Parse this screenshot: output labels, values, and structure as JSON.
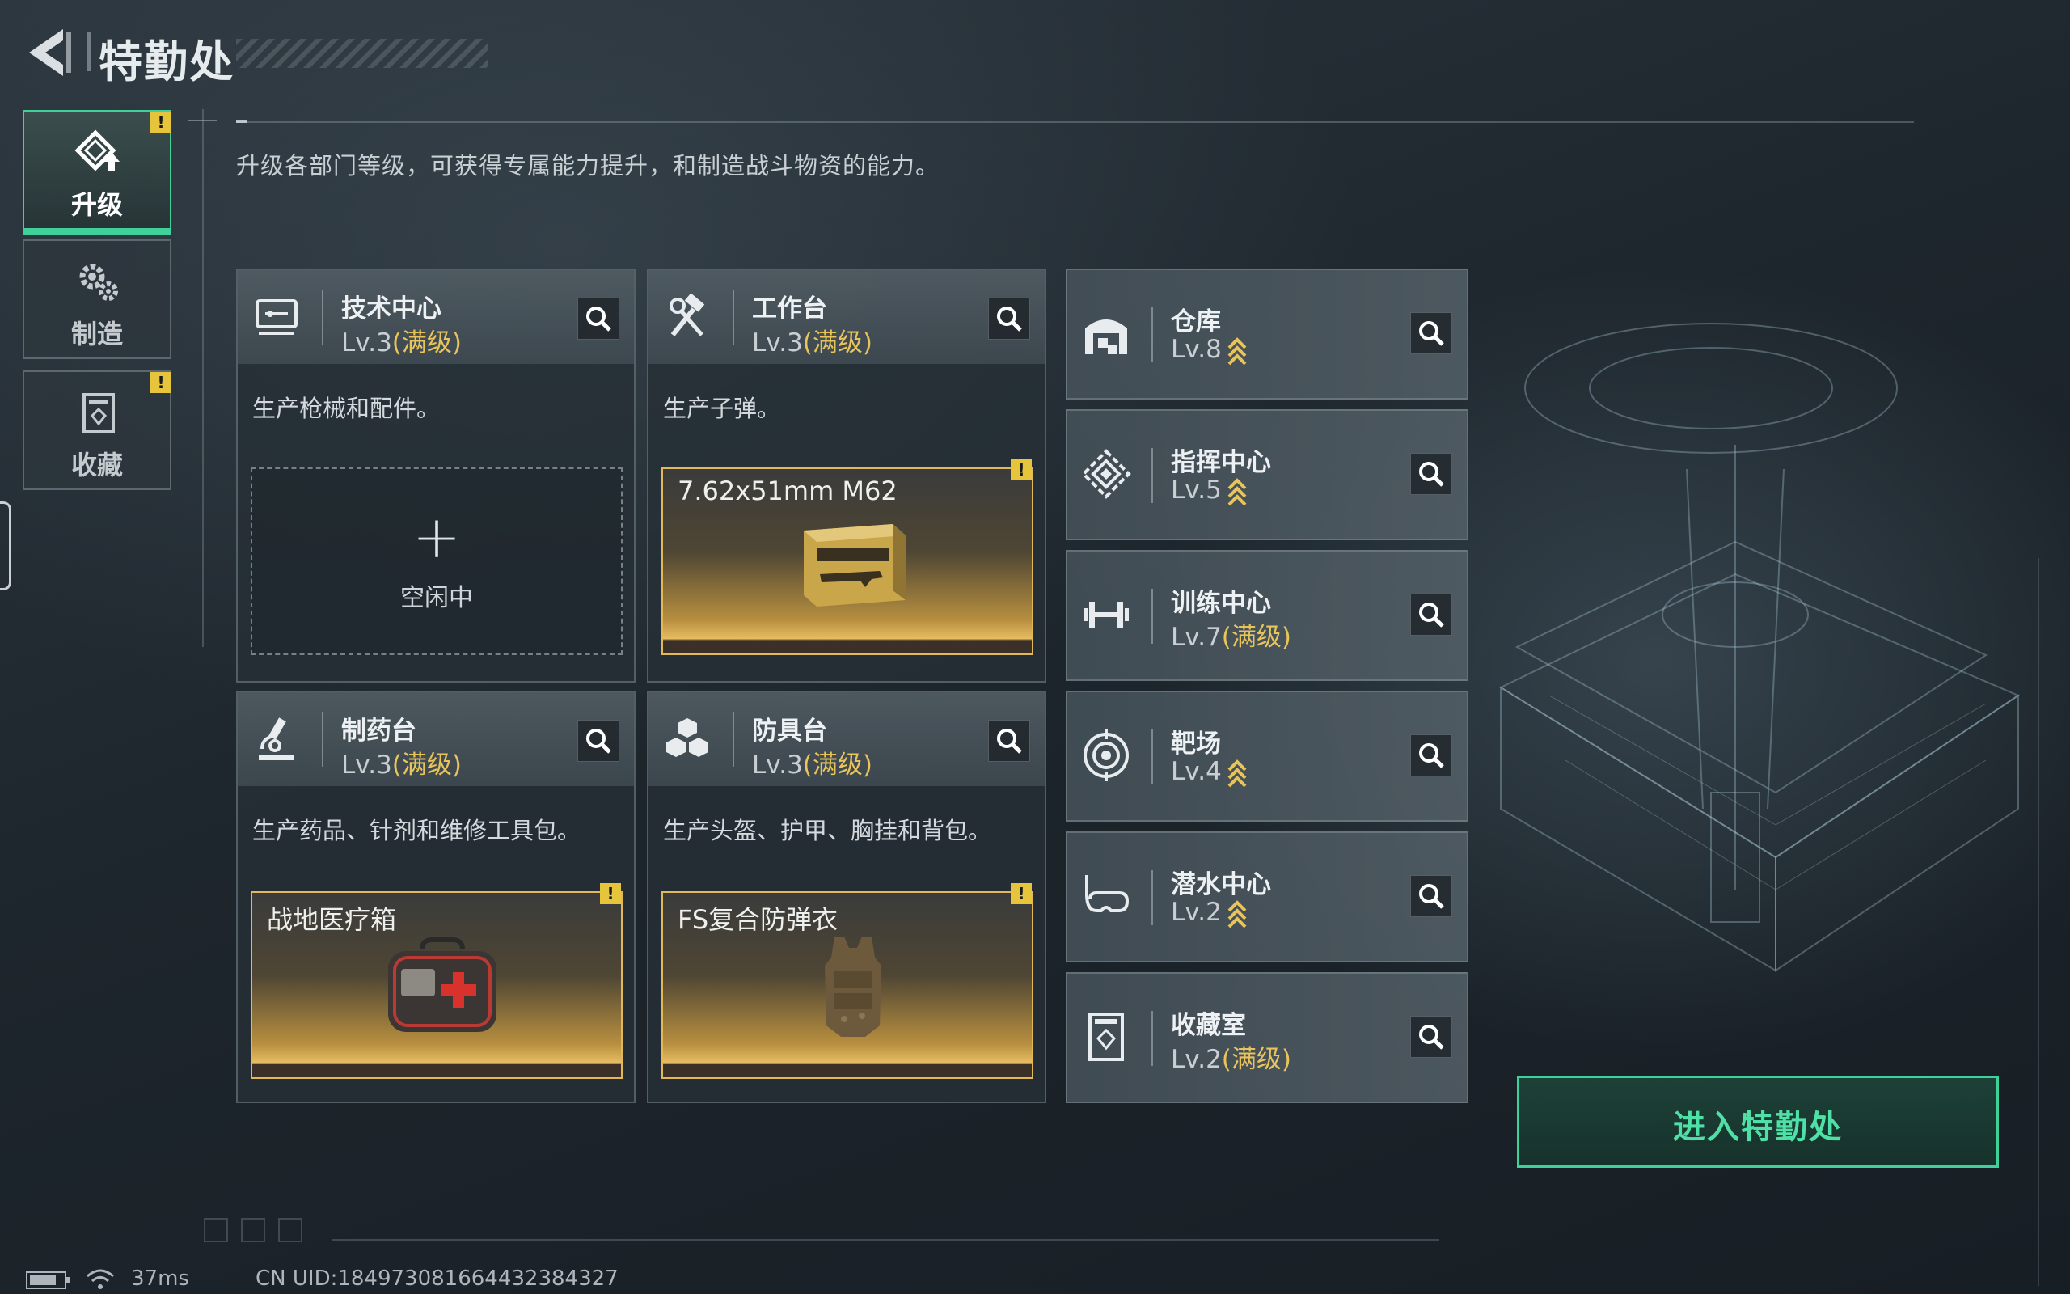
{
  "header": {
    "title": "特勤处",
    "subtitle": "升级各部门等级，可获得专属能力提升，和制造战斗物资的能力。"
  },
  "nav": [
    {
      "label": "升级",
      "active": true,
      "warn": "!"
    },
    {
      "label": "制造",
      "active": false
    },
    {
      "label": "收藏",
      "active": false,
      "warn": "!"
    }
  ],
  "cards": [
    {
      "name": "技术中心",
      "level": "Lv.3",
      "maxed": "(满级)",
      "desc": "生产枪械和配件。",
      "slot": {
        "type": "empty",
        "plus": "+",
        "label": "空闲中"
      }
    },
    {
      "name": "工作台",
      "level": "Lv.3",
      "maxed": "(满级)",
      "desc": "生产子弹。",
      "slot": {
        "type": "item",
        "label": "7.62x51mm M62",
        "icon": "ammo-box-icon",
        "warn": "!"
      }
    },
    {
      "name": "制药台",
      "level": "Lv.3",
      "maxed": "(满级)",
      "desc": "生产药品、针剂和维修工具包。",
      "slot": {
        "type": "item",
        "label": "战地医疗箱",
        "icon": "first-aid-kit-icon",
        "warn": "!"
      }
    },
    {
      "name": "防具台",
      "level": "Lv.3",
      "maxed": "(满级)",
      "desc": "生产头盔、护甲、胸挂和背包。",
      "slot": {
        "type": "item",
        "label": "FS复合防弹衣",
        "icon": "body-armor-icon",
        "warn": "!"
      }
    }
  ],
  "buildings": [
    {
      "name": "仓库",
      "level": "Lv.8",
      "maxed": "",
      "upgradable": true,
      "icon": "warehouse-icon"
    },
    {
      "name": "指挥中心",
      "level": "Lv.5",
      "maxed": "",
      "upgradable": true,
      "icon": "command-center-icon"
    },
    {
      "name": "训练中心",
      "level": "Lv.7",
      "maxed": "(满级)",
      "upgradable": false,
      "icon": "dumbbell-icon"
    },
    {
      "name": "靶场",
      "level": "Lv.4",
      "maxed": "",
      "upgradable": true,
      "icon": "target-icon"
    },
    {
      "name": "潜水中心",
      "level": "Lv.2",
      "maxed": "",
      "upgradable": true,
      "icon": "diving-mask-icon"
    },
    {
      "name": "收藏室",
      "level": "Lv.2",
      "maxed": "(满级)",
      "upgradable": false,
      "icon": "collection-icon"
    }
  ],
  "enter_button": "进入特勤处",
  "status_bar": {
    "ping": "37ms",
    "uid": "CN UID:1849730816644323843​27"
  },
  "colors": {
    "accent": "#3fd199",
    "maxed": "#e8c45a",
    "warn": "#e6c43c",
    "item_gold": "#e2b95a"
  }
}
